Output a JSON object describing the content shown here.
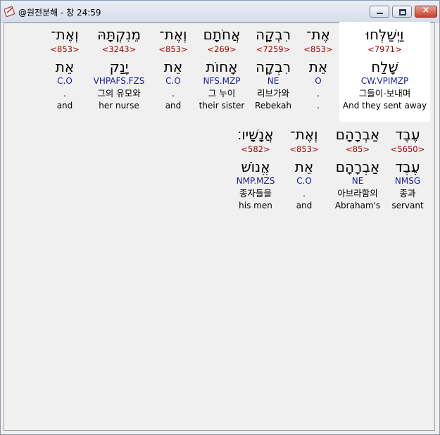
{
  "window": {
    "title": "@원전분해 - 창 24:59",
    "icon": "verse-icon",
    "controls": {
      "minimize": "minimize-icon",
      "maximize": "maximize-icon",
      "close": "×"
    }
  },
  "rows": [
    [
      {
        "hebrew": "וַיְשַׁלְּחוּ",
        "strong": "<7971>",
        "lemma": "שָׁלַח",
        "morph": "CW.VPIMZP",
        "korean": "그들이-보내며",
        "english": "And they sent away",
        "selected": true
      },
      {
        "hebrew": "אֶת־",
        "strong": "<853>",
        "lemma": "אֵת",
        "morph": "O",
        "korean": ".",
        "english": "."
      },
      {
        "hebrew": "רִבְקָה",
        "strong": "<7259>",
        "lemma": "רִבְקָה",
        "morph": "NE",
        "korean": "리브가와",
        "english": "Rebekah"
      },
      {
        "hebrew": "אֲחֹתָם",
        "strong": "<269>",
        "lemma": "אָחוֹת",
        "morph": "NFS.MZP",
        "korean": "그 누이",
        "english": "their sister"
      },
      {
        "hebrew": "וְאֶת־",
        "strong": "<853>",
        "lemma": "אֵת",
        "morph": "C.O",
        "korean": ".",
        "english": "and"
      },
      {
        "hebrew": "מֵנִקְתָּהּ",
        "strong": "<3243>",
        "lemma": "יָנַק",
        "morph": "VHPAFS.FZS",
        "korean": "그의 유모와",
        "english": "her nurse"
      },
      {
        "hebrew": "וְאֶת־",
        "strong": "<853>",
        "lemma": "אֵת",
        "morph": "C.O",
        "korean": ".",
        "english": "and"
      }
    ],
    [
      {
        "hebrew": "עֶבֶד",
        "strong": "<5650>",
        "lemma": "עֶבֶד",
        "morph": "NMSG",
        "korean": "종과",
        "english": "servant"
      },
      {
        "hebrew": "אַבְרָהָם",
        "strong": "<85>",
        "lemma": "אַבְרָהָם",
        "morph": "NE",
        "korean": "아브라함의",
        "english": "Abraham's"
      },
      {
        "hebrew": "וְאֶת־",
        "strong": "<853>",
        "lemma": "אֵת",
        "morph": "C.O",
        "korean": ".",
        "english": "and"
      },
      {
        "hebrew": "אֲנָשָׁיו׃",
        "strong": "<582>",
        "lemma": "אֱנוֹשׁ",
        "morph": "NMP.MZS",
        "korean": "종자들을",
        "english": "his men"
      }
    ]
  ]
}
